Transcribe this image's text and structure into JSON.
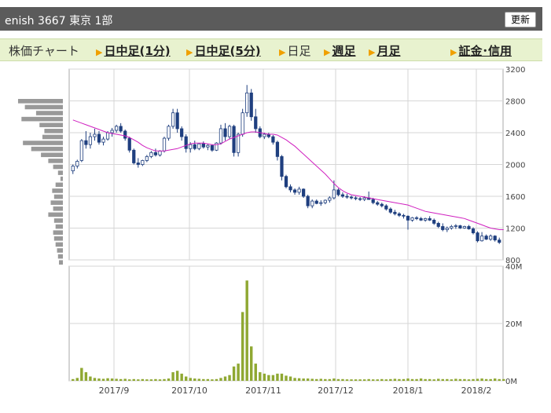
{
  "header": {
    "title": "enish  3667  東京 1部",
    "refresh_label": "更新"
  },
  "nav": {
    "label": "株価チャート",
    "items": [
      {
        "label": "日中足(1分)",
        "link": true
      },
      {
        "label": "日中足(5分)",
        "link": true
      },
      {
        "label": "日足",
        "link": false
      },
      {
        "label": "週足",
        "link": true
      },
      {
        "label": "月足",
        "link": true
      },
      {
        "label": "証金･信用",
        "link": true
      }
    ]
  },
  "colors": {
    "up": "#ffffff",
    "down": "#1f3f7f",
    "ma": "#d020c0",
    "volume": "#8fa832",
    "grid": "#d6d6d6",
    "profile": "#999999"
  },
  "chart_data": [
    {
      "type": "candlestick",
      "y_ticks": [
        "3200",
        "2800",
        "2400",
        "2000",
        "1600",
        "1200",
        "800"
      ],
      "ylim": [
        800,
        3200
      ],
      "x_ticks": [
        "2017/9",
        "2017/10",
        "2017/11",
        "2017/12",
        "2018/1",
        "2018/2"
      ],
      "ohlc": [
        [
          1920,
          2000,
          1880,
          1980
        ],
        [
          1980,
          2060,
          1950,
          2040
        ],
        [
          2050,
          2320,
          2030,
          2300
        ],
        [
          2300,
          2420,
          2200,
          2250
        ],
        [
          2250,
          2400,
          2200,
          2350
        ],
        [
          2350,
          2450,
          2300,
          2380
        ],
        [
          2380,
          2420,
          2250,
          2280
        ],
        [
          2280,
          2350,
          2240,
          2320
        ],
        [
          2320,
          2420,
          2300,
          2400
        ],
        [
          2400,
          2460,
          2350,
          2430
        ],
        [
          2430,
          2500,
          2400,
          2480
        ],
        [
          2480,
          2520,
          2400,
          2420
        ],
        [
          2420,
          2440,
          2300,
          2330
        ],
        [
          2330,
          2350,
          2150,
          2180
        ],
        [
          2180,
          2200,
          2000,
          2020
        ],
        [
          2020,
          2080,
          1960,
          2000
        ],
        [
          2000,
          2060,
          1980,
          2050
        ],
        [
          2050,
          2120,
          2030,
          2100
        ],
        [
          2100,
          2170,
          2080,
          2150
        ],
        [
          2150,
          2200,
          2100,
          2120
        ],
        [
          2120,
          2180,
          2100,
          2170
        ],
        [
          2170,
          2350,
          2150,
          2330
        ],
        [
          2330,
          2500,
          2300,
          2480
        ],
        [
          2480,
          2700,
          2450,
          2650
        ],
        [
          2650,
          2700,
          2400,
          2450
        ],
        [
          2450,
          2480,
          2300,
          2350
        ],
        [
          2350,
          2380,
          2150,
          2200
        ],
        [
          2200,
          2280,
          2150,
          2250
        ],
        [
          2250,
          2300,
          2180,
          2200
        ],
        [
          2200,
          2270,
          2180,
          2260
        ],
        [
          2260,
          2290,
          2200,
          2220
        ],
        [
          2220,
          2260,
          2180,
          2240
        ],
        [
          2240,
          2250,
          2160,
          2180
        ],
        [
          2180,
          2280,
          2170,
          2270
        ],
        [
          2270,
          2500,
          2250,
          2450
        ],
        [
          2450,
          2520,
          2300,
          2350
        ],
        [
          2350,
          2500,
          2320,
          2480
        ],
        [
          2480,
          2500,
          2100,
          2150
        ],
        [
          2150,
          2400,
          2100,
          2380
        ],
        [
          2380,
          2700,
          2350,
          2650
        ],
        [
          2650,
          3000,
          2600,
          2900
        ],
        [
          2900,
          2950,
          2550,
          2600
        ],
        [
          2600,
          2700,
          2400,
          2450
        ],
        [
          2450,
          2480,
          2330,
          2350
        ],
        [
          2350,
          2400,
          2320,
          2380
        ],
        [
          2380,
          2400,
          2330,
          2350
        ],
        [
          2350,
          2370,
          2250,
          2280
        ],
        [
          2280,
          2300,
          2050,
          2100
        ],
        [
          2100,
          2120,
          1800,
          1850
        ],
        [
          1850,
          1870,
          1700,
          1720
        ],
        [
          1720,
          1750,
          1650,
          1680
        ],
        [
          1680,
          1700,
          1620,
          1650
        ],
        [
          1650,
          1720,
          1620,
          1690
        ],
        [
          1690,
          1700,
          1580,
          1600
        ],
        [
          1600,
          1620,
          1450,
          1480
        ],
        [
          1480,
          1560,
          1450,
          1540
        ],
        [
          1540,
          1560,
          1500,
          1510
        ],
        [
          1510,
          1550,
          1480,
          1520
        ],
        [
          1520,
          1560,
          1500,
          1550
        ],
        [
          1550,
          1600,
          1520,
          1580
        ],
        [
          1580,
          1800,
          1560,
          1680
        ],
        [
          1680,
          1700,
          1600,
          1620
        ],
        [
          1620,
          1650,
          1580,
          1600
        ],
        [
          1600,
          1630,
          1570,
          1590
        ],
        [
          1590,
          1610,
          1560,
          1580
        ],
        [
          1580,
          1600,
          1550,
          1570
        ],
        [
          1570,
          1590,
          1540,
          1560
        ],
        [
          1560,
          1600,
          1540,
          1580
        ],
        [
          1580,
          1660,
          1560,
          1560
        ],
        [
          1560,
          1580,
          1500,
          1520
        ],
        [
          1520,
          1540,
          1480,
          1500
        ],
        [
          1500,
          1520,
          1460,
          1480
        ],
        [
          1480,
          1500,
          1420,
          1440
        ],
        [
          1440,
          1460,
          1380,
          1400
        ],
        [
          1400,
          1430,
          1360,
          1380
        ],
        [
          1380,
          1400,
          1340,
          1360
        ],
        [
          1360,
          1380,
          1320,
          1350
        ],
        [
          1350,
          1360,
          1180,
          1300
        ],
        [
          1300,
          1340,
          1280,
          1330
        ],
        [
          1330,
          1350,
          1300,
          1320
        ],
        [
          1320,
          1340,
          1290,
          1300
        ],
        [
          1300,
          1330,
          1280,
          1320
        ],
        [
          1320,
          1350,
          1290,
          1300
        ],
        [
          1300,
          1320,
          1240,
          1260
        ],
        [
          1260,
          1280,
          1200,
          1220
        ],
        [
          1220,
          1260,
          1160,
          1180
        ],
        [
          1180,
          1220,
          1150,
          1200
        ],
        [
          1200,
          1240,
          1180,
          1220
        ],
        [
          1220,
          1250,
          1190,
          1230
        ],
        [
          1230,
          1240,
          1190,
          1200
        ],
        [
          1200,
          1230,
          1190,
          1220
        ],
        [
          1220,
          1240,
          1180,
          1190
        ],
        [
          1190,
          1210,
          1120,
          1140
        ],
        [
          1140,
          1160,
          1020,
          1040
        ],
        [
          1040,
          1150,
          1030,
          1100
        ],
        [
          1100,
          1120,
          1050,
          1060
        ],
        [
          1060,
          1120,
          1040,
          1100
        ],
        [
          1100,
          1110,
          1030,
          1050
        ],
        [
          1050,
          1080,
          1000,
          1020
        ]
      ],
      "ma": [
        2560,
        2540,
        2520,
        2500,
        2480,
        2460,
        2440,
        2420,
        2400,
        2390,
        2380,
        2370,
        2360,
        2340,
        2310,
        2280,
        2240,
        2210,
        2190,
        2170,
        2170,
        2170,
        2180,
        2190,
        2200,
        2220,
        2240,
        2260,
        2270,
        2270,
        2270,
        2260,
        2250,
        2250,
        2260,
        2290,
        2320,
        2340,
        2360,
        2380,
        2400,
        2410,
        2410,
        2400,
        2390,
        2380,
        2380,
        2370,
        2340,
        2310,
        2270,
        2230,
        2180,
        2130,
        2080,
        2030,
        1980,
        1930,
        1880,
        1820,
        1760,
        1710,
        1670,
        1640,
        1620,
        1610,
        1600,
        1590,
        1580,
        1570,
        1560,
        1550,
        1540,
        1530,
        1520,
        1510,
        1500,
        1490,
        1470,
        1450,
        1430,
        1410,
        1400,
        1390,
        1380,
        1370,
        1360,
        1350,
        1340,
        1330,
        1320,
        1300,
        1280,
        1260,
        1240,
        1220,
        1200,
        1190,
        1180,
        1180
      ],
      "price_profile": [
        0.92,
        0.78,
        0.55,
        0.85,
        0.48,
        0.38,
        0.42,
        0.82,
        0.65,
        0.45,
        0.3,
        0.2,
        0.1,
        0.05,
        0.15,
        0.22,
        0.18,
        0.25,
        0.2,
        0.3,
        0.18,
        0.15,
        0.2,
        0.18,
        0.15,
        0.12,
        0.1,
        0.08
      ]
    },
    {
      "type": "bar",
      "series_role": "volume",
      "y_ticks": [
        "40M",
        "20M",
        "0M"
      ],
      "ylim": [
        0,
        40
      ],
      "values": [
        0.6,
        1.0,
        4.5,
        3.0,
        1.5,
        1.0,
        0.8,
        0.7,
        0.9,
        0.8,
        0.7,
        0.6,
        0.7,
        0.5,
        0.6,
        0.5,
        0.6,
        0.5,
        0.5,
        0.6,
        0.5,
        0.6,
        0.8,
        3.0,
        3.5,
        2.5,
        1.5,
        1.0,
        0.8,
        0.7,
        0.6,
        0.6,
        0.5,
        0.6,
        1.0,
        1.5,
        2.0,
        5.0,
        6.0,
        24.0,
        35.0,
        12.0,
        6.0,
        3.0,
        2.5,
        2.0,
        2.0,
        2.5,
        2.5,
        1.8,
        1.5,
        1.0,
        0.9,
        0.8,
        0.8,
        0.7,
        0.6,
        0.7,
        0.6,
        0.6,
        0.8,
        0.6,
        0.6,
        0.5,
        0.5,
        0.5,
        0.5,
        0.5,
        0.6,
        0.5,
        0.5,
        0.6,
        0.5,
        0.6,
        0.7,
        0.6,
        0.6,
        0.8,
        0.6,
        0.6,
        0.8,
        0.6,
        0.6,
        0.5,
        0.7,
        0.6,
        0.6,
        0.5,
        0.7,
        0.6,
        0.6,
        0.5,
        0.6,
        0.7,
        0.8,
        0.6,
        0.6,
        0.8,
        0.6,
        0.6
      ]
    }
  ]
}
